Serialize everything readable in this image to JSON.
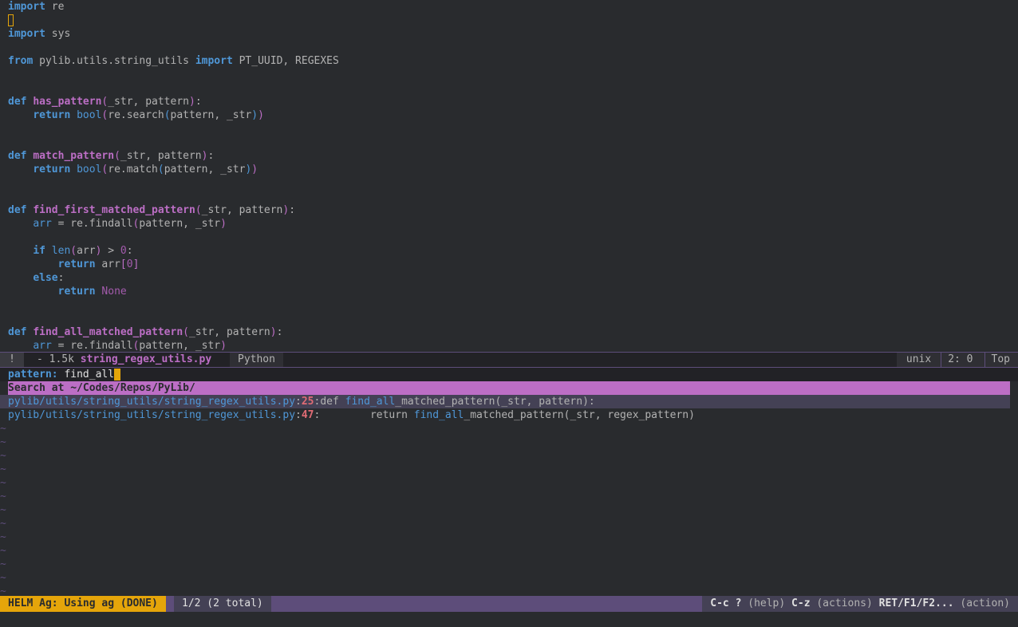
{
  "editor": {
    "lines": [
      [
        {
          "t": "import",
          "c": "kw"
        },
        {
          "t": " re"
        }
      ],
      [
        {
          "t": "",
          "c": "cursor"
        }
      ],
      [
        {
          "t": "import",
          "c": "kw"
        },
        {
          "t": " sys"
        }
      ],
      [
        {
          "t": ""
        }
      ],
      [
        {
          "t": "from",
          "c": "kw"
        },
        {
          "t": " pylib.utils.string_utils "
        },
        {
          "t": "import",
          "c": "kw"
        },
        {
          "t": " PT_UUID, REGEXES"
        }
      ],
      [
        {
          "t": ""
        }
      ],
      [
        {
          "t": ""
        }
      ],
      [
        {
          "t": "def",
          "c": "kw"
        },
        {
          "t": " "
        },
        {
          "t": "has_pattern",
          "c": "fn"
        },
        {
          "t": "(",
          "c": "br"
        },
        {
          "t": "_str, pattern"
        },
        {
          "t": ")",
          "c": "br"
        },
        {
          "t": ":"
        }
      ],
      [
        {
          "t": "    "
        },
        {
          "t": "return",
          "c": "kw"
        },
        {
          "t": " "
        },
        {
          "t": "bool",
          "c": "bi"
        },
        {
          "t": "(",
          "c": "br"
        },
        {
          "t": "re.search"
        },
        {
          "t": "(",
          "c": "bi"
        },
        {
          "t": "pattern, _str"
        },
        {
          "t": ")",
          "c": "bi"
        },
        {
          "t": ")",
          "c": "br"
        }
      ],
      [
        {
          "t": ""
        }
      ],
      [
        {
          "t": ""
        }
      ],
      [
        {
          "t": "def",
          "c": "kw"
        },
        {
          "t": " "
        },
        {
          "t": "match_pattern",
          "c": "fn"
        },
        {
          "t": "(",
          "c": "br"
        },
        {
          "t": "_str, pattern"
        },
        {
          "t": ")",
          "c": "br"
        },
        {
          "t": ":"
        }
      ],
      [
        {
          "t": "    "
        },
        {
          "t": "return",
          "c": "kw"
        },
        {
          "t": " "
        },
        {
          "t": "bool",
          "c": "bi"
        },
        {
          "t": "(",
          "c": "br"
        },
        {
          "t": "re.match"
        },
        {
          "t": "(",
          "c": "bi"
        },
        {
          "t": "pattern, _str"
        },
        {
          "t": ")",
          "c": "bi"
        },
        {
          "t": ")",
          "c": "br"
        }
      ],
      [
        {
          "t": ""
        }
      ],
      [
        {
          "t": ""
        }
      ],
      [
        {
          "t": "def",
          "c": "kw"
        },
        {
          "t": " "
        },
        {
          "t": "find_first_matched_pattern",
          "c": "fn"
        },
        {
          "t": "(",
          "c": "br"
        },
        {
          "t": "_str, pattern"
        },
        {
          "t": ")",
          "c": "br"
        },
        {
          "t": ":"
        }
      ],
      [
        {
          "t": "    "
        },
        {
          "t": "arr",
          "c": "bi"
        },
        {
          "t": " = re.findall"
        },
        {
          "t": "(",
          "c": "br"
        },
        {
          "t": "pattern, _str"
        },
        {
          "t": ")",
          "c": "br"
        }
      ],
      [
        {
          "t": ""
        }
      ],
      [
        {
          "t": "    "
        },
        {
          "t": "if",
          "c": "kw"
        },
        {
          "t": " "
        },
        {
          "t": "len",
          "c": "bi"
        },
        {
          "t": "(",
          "c": "br"
        },
        {
          "t": "arr"
        },
        {
          "t": ")",
          "c": "br"
        },
        {
          "t": " > "
        },
        {
          "t": "0",
          "c": "cst"
        },
        {
          "t": ":"
        }
      ],
      [
        {
          "t": "        "
        },
        {
          "t": "return",
          "c": "kw"
        },
        {
          "t": " arr"
        },
        {
          "t": "[",
          "c": "br"
        },
        {
          "t": "0",
          "c": "cst"
        },
        {
          "t": "]",
          "c": "br"
        }
      ],
      [
        {
          "t": "    "
        },
        {
          "t": "else",
          "c": "kw"
        },
        {
          "t": ":"
        }
      ],
      [
        {
          "t": "        "
        },
        {
          "t": "return",
          "c": "kw"
        },
        {
          "t": " "
        },
        {
          "t": "None",
          "c": "cst"
        }
      ],
      [
        {
          "t": ""
        }
      ],
      [
        {
          "t": ""
        }
      ],
      [
        {
          "t": "def",
          "c": "kw"
        },
        {
          "t": " "
        },
        {
          "t": "find_all_matched_pattern",
          "c": "fn"
        },
        {
          "t": "(",
          "c": "br"
        },
        {
          "t": "_str, pattern"
        },
        {
          "t": ")",
          "c": "br"
        },
        {
          "t": ":"
        }
      ],
      [
        {
          "t": "    "
        },
        {
          "t": "arr",
          "c": "bi"
        },
        {
          "t": " = re.findall"
        },
        {
          "t": "(",
          "c": "br"
        },
        {
          "t": "pattern, _str"
        },
        {
          "t": ")",
          "c": "br"
        }
      ]
    ]
  },
  "modeline": {
    "info_icon": "!",
    "buffer_prefix": "- 1.5k ",
    "buffer_name": "string_regex_utils.py",
    "major_mode": "Python",
    "encoding": "unix",
    "position": "2: 0",
    "scroll": "Top"
  },
  "helm": {
    "prompt_label": "pattern: ",
    "prompt_value": "find_all",
    "header": "Search at ~/Codes/Repos/PyLib/",
    "results": [
      {
        "path": "pylib/utils/string_utils/string_regex_utils.py",
        "line": "25",
        "before": "def ",
        "match": "find_all",
        "after": "_matched_pattern(_str, pattern):",
        "selected": true
      },
      {
        "path": "pylib/utils/string_utils/string_regex_utils.py",
        "line": "47",
        "before": "        return ",
        "match": "find_all",
        "after": "_matched_pattern(_str, regex_pattern)",
        "selected": false
      }
    ],
    "tilde": "~",
    "tilde_count": 13
  },
  "bottombar": {
    "mode": "HELM Ag: Using ag (DONE)",
    "count": "1/2 (2 total)",
    "help_k1": "C-c ?",
    "help_v1": " (help) ",
    "help_k2": "C-z",
    "help_v2": " (actions) ",
    "help_k3": "RET/F1/F2...",
    "help_v3": " (action)"
  }
}
